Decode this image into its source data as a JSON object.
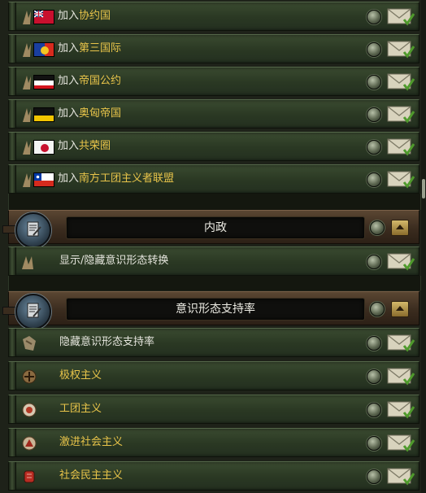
{
  "join_rows": [
    {
      "prefix": "加入",
      "name": "协约国",
      "flag": "uk"
    },
    {
      "prefix": "加入",
      "name": "第三国际",
      "flag": "comintern"
    },
    {
      "prefix": "加入",
      "name": "帝国公约",
      "flag": "german-empire"
    },
    {
      "prefix": "加入",
      "name": "奥匈帝国",
      "flag": "austria-hungary"
    },
    {
      "prefix": "加入",
      "name": "共荣圈",
      "flag": "japan"
    },
    {
      "prefix": "加入",
      "name": "南方工团主义者联盟",
      "flag": "chile"
    }
  ],
  "domestic": {
    "title": "内政",
    "rows": [
      {
        "label": "显示/隐藏意识形态转换"
      }
    ]
  },
  "ideology": {
    "title": "意识形态支持率",
    "rows": [
      {
        "label": "隐藏意识形态支持率",
        "style": "plain",
        "icon": "hide-support-icon"
      },
      {
        "label": "极权主义",
        "style": "gold",
        "icon": "totalist-icon"
      },
      {
        "label": "工团主义",
        "style": "gold",
        "icon": "syndicalist-icon"
      },
      {
        "label": "激进社会主义",
        "style": "gold",
        "icon": "radical-socialist-icon"
      },
      {
        "label": "社会民主主义",
        "style": "gold",
        "icon": "social-democrat-icon"
      }
    ]
  },
  "colors": {
    "highlight": "#e8c44a",
    "text": "#e6e6de",
    "panel": "#2a3823",
    "header": "#3b2c1f"
  }
}
